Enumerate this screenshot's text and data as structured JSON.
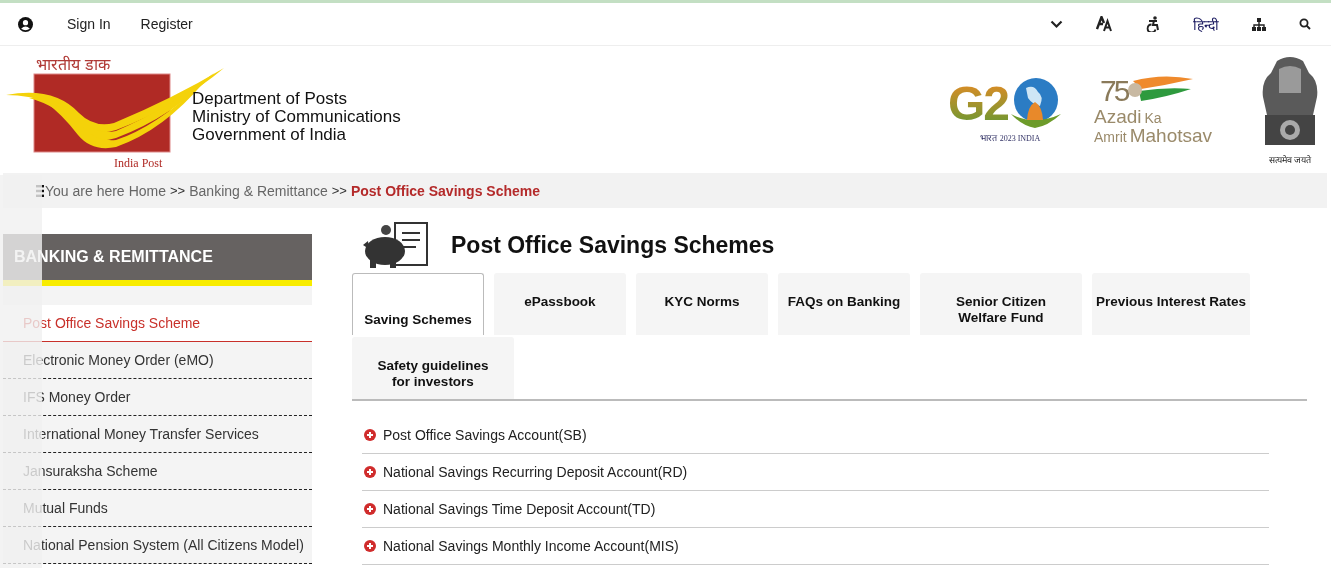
{
  "top_bar": {
    "links": [
      "Sign In",
      "Register"
    ],
    "language": "हिन्दी"
  },
  "header": {
    "logo": {
      "hindi": "भारतीय डाक",
      "english": "India Post"
    },
    "org_lines": [
      "Department of Posts",
      "Ministry of Communications",
      "Government of India"
    ],
    "g20": {
      "mark": "G2",
      "tagline_hindi": "भारत",
      "tagline": "2023 INDIA"
    },
    "azadi": {
      "number": "75",
      "words": [
        "Azadi",
        "Ka",
        "Amrit",
        "Mahotsav"
      ]
    },
    "emblem": {
      "motto": "सत्यमेव जयते"
    }
  },
  "breadcrumb": {
    "prefix": "You are here",
    "separator": ">>",
    "items": [
      {
        "label": "Home",
        "current": false
      },
      {
        "label": "Banking & Remittance",
        "current": false
      },
      {
        "label": "Post Office Savings Scheme",
        "current": true
      }
    ]
  },
  "sidebar": {
    "title": "BANKING & REMITTANCE",
    "items": [
      {
        "label": "Post Office Savings Scheme",
        "selected": true
      },
      {
        "label": "Electronic Money Order (eMO)",
        "selected": false
      },
      {
        "label": "IFS Money Order",
        "selected": false
      },
      {
        "label": "International Money Transfer Services",
        "selected": false
      },
      {
        "label": "Jansuraksha Scheme",
        "selected": false
      },
      {
        "label": "Mutual Funds",
        "selected": false
      },
      {
        "label": "National Pension System (All Citizens Model)",
        "selected": false
      }
    ]
  },
  "main": {
    "title": "Post Office Savings Schemes",
    "tabs": [
      {
        "label": "Saving Schemes",
        "selected": true
      },
      {
        "label": "ePassbook",
        "selected": false
      },
      {
        "label": "KYC Norms",
        "selected": false
      },
      {
        "label": "FAQs on Banking",
        "selected": false
      },
      {
        "label": "Senior Citizen Welfare Fund",
        "selected": false
      },
      {
        "label": "Previous Interest Rates",
        "selected": false
      },
      {
        "label": "Safety guidelines for investors",
        "selected": false
      }
    ],
    "accordion": [
      {
        "label": "Post Office Savings Account(SB)",
        "expanded": false
      },
      {
        "label": "National Savings Recurring Deposit Account(RD)",
        "expanded": false
      },
      {
        "label": "National Savings Time Deposit Account(TD)",
        "expanded": false
      },
      {
        "label": "National Savings Monthly Income Account(MIS)",
        "expanded": false
      }
    ]
  }
}
